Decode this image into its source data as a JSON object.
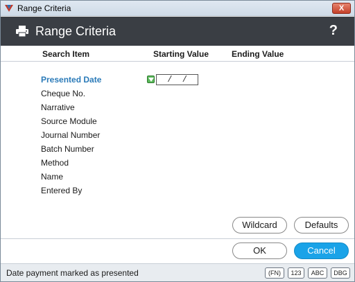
{
  "window": {
    "title": "Range Criteria",
    "close_label": "X"
  },
  "header": {
    "title": "Range Criteria",
    "help_label": "?"
  },
  "columns": {
    "search_item": "Search Item",
    "starting_value": "Starting Value",
    "ending_value": "Ending Value"
  },
  "criteria": [
    {
      "label": "Presented Date",
      "selected": true
    },
    {
      "label": "Cheque No.",
      "selected": false
    },
    {
      "label": "Narrative",
      "selected": false
    },
    {
      "label": "Source Module",
      "selected": false
    },
    {
      "label": "Journal Number",
      "selected": false
    },
    {
      "label": "Batch Number",
      "selected": false
    },
    {
      "label": "Method",
      "selected": false
    },
    {
      "label": "Name",
      "selected": false
    },
    {
      "label": "Entered By",
      "selected": false
    }
  ],
  "date_field": {
    "value": " /  /"
  },
  "buttons": {
    "wildcard": "Wildcard",
    "defaults": "Defaults",
    "ok": "OK",
    "cancel": "Cancel"
  },
  "status": {
    "text": "Date payment marked as presented",
    "keys": [
      "(FN)",
      "123",
      "ABC",
      "DBG"
    ]
  },
  "colors": {
    "selected_text": "#2a7ab8",
    "cancel_button": "#1aa3e8",
    "header_bg": "#3a3e44"
  }
}
